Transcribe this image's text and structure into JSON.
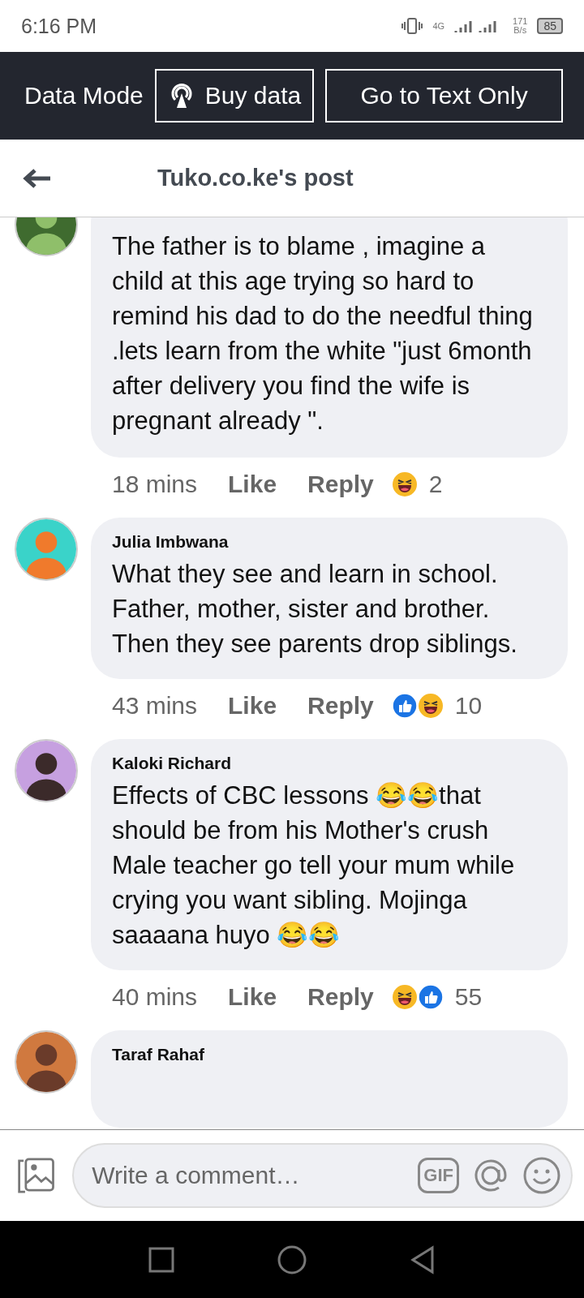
{
  "status_bar": {
    "time": "6:16 PM",
    "network": "4G",
    "speed": "171",
    "speed_unit": "B/s",
    "battery": "85"
  },
  "data_bar": {
    "label": "Data Mode",
    "buttons": [
      {
        "kind": "buy",
        "label": "Buy data"
      },
      {
        "kind": "text",
        "label": "Go to Text Only"
      }
    ]
  },
  "header": {
    "title": "Tuko.co.ke's post"
  },
  "comments": [
    {
      "text": "The father is to blame , imagine a child at this age  trying so hard to remind his dad  to do the needful thing .lets learn from the white \"just 6month after delivery you find the wife is pregnant already \".",
      "time": "18 mins",
      "like": "Like",
      "reply": "Reply",
      "reactions": [
        {
          "kind": "haha"
        }
      ],
      "count": "2"
    },
    {
      "name": "Julia Imbwana",
      "text": "What they see and learn in school. Father,  mother,  sister and brother. Then they see parents drop siblings.",
      "time": "43 mins",
      "like": "Like",
      "reply": "Reply",
      "reactions": [
        {
          "kind": "like"
        },
        {
          "kind": "haha"
        }
      ],
      "count": "10"
    },
    {
      "name": "Kaloki Richard",
      "text": "Effects of CBC lessons 😂😂that should be from his Mother's crush Male teacher go tell your mum while crying you want sibling. Mojinga saaaana huyo 😂😂",
      "time": "40 mins",
      "like": "Like",
      "reply": "Reply",
      "reactions": [
        {
          "kind": "haha"
        },
        {
          "kind": "like"
        }
      ],
      "count": "55"
    },
    {
      "name": "Taraf Rahaf"
    }
  ],
  "composer": {
    "placeholder": "Write a comment…",
    "gif": "GIF"
  }
}
